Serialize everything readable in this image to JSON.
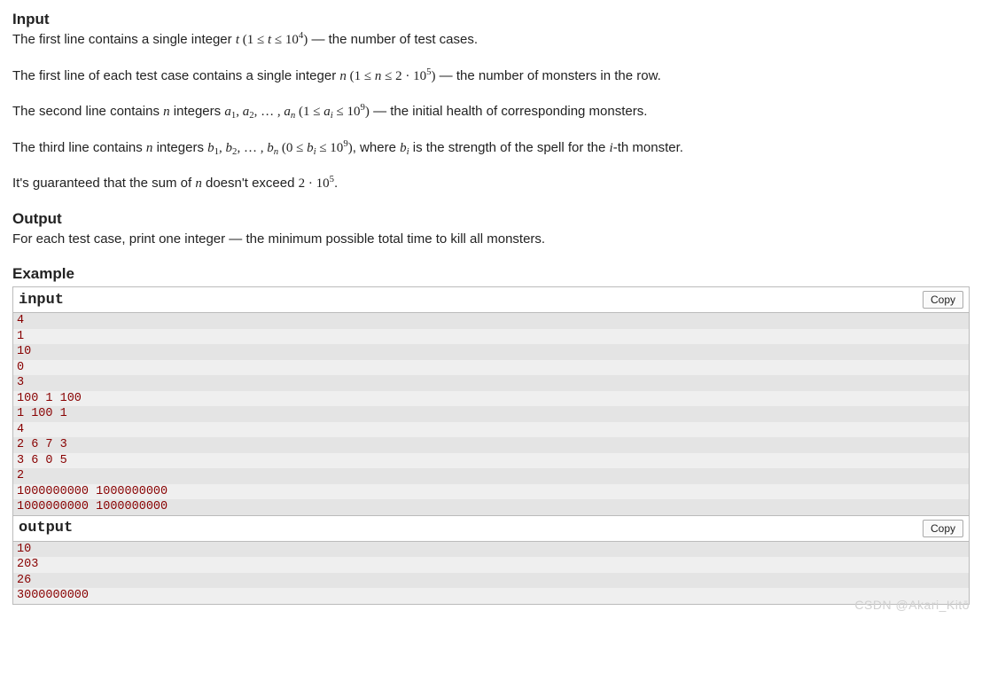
{
  "sections": {
    "input_title": "Input",
    "output_title": "Output",
    "example_title": "Example"
  },
  "input_desc": {
    "line1_a": "The first line contains a single integer ",
    "line1_b": " — the number of test cases.",
    "line1_t": "t",
    "line1_cond_open": " (",
    "line1_cond_a": "1 ≤ ",
    "line1_cond_b": " ≤ 10",
    "line1_cond_exp": "4",
    "line1_cond_close": ")",
    "line2_a": "The first line of each test case contains a single integer ",
    "line2_n": "n",
    "line2_b": " (",
    "line2_c": "1 ≤ ",
    "line2_d": " ≤ 2 · 10",
    "line2_exp": "5",
    "line2_e": ")",
    "line2_f": " — the number of monsters in the row.",
    "line3_a": "The second line contains ",
    "line3_n": "n",
    "line3_b": " integers ",
    "line3_seq_a": "a",
    "line3_sub1": "1",
    "line3_sep": ", ",
    "line3_sub2": "2",
    "line3_dots": ", … , ",
    "line3_subn": "n",
    "line3_c": " (",
    "line3_cond_a": "1 ≤ ",
    "line3_ai": "a",
    "line3_ai_sub": "i",
    "line3_cond_b": " ≤ 10",
    "line3_exp": "9",
    "line3_d": ")",
    "line3_e": " — the initial health of corresponding monsters.",
    "line4_a": "The third line contains ",
    "line4_n": "n",
    "line4_b": " integers ",
    "line4_seq_b": "b",
    "line4_sub1": "1",
    "line4_sep": ", ",
    "line4_sub2": "2",
    "line4_dots": ", … , ",
    "line4_subn": "n",
    "line4_c": " (",
    "line4_cond_a": "0 ≤ ",
    "line4_bi": "b",
    "line4_bi_sub": "i",
    "line4_cond_b": " ≤ 10",
    "line4_exp": "9",
    "line4_d": ")",
    "line4_e": ", where ",
    "line4_f": " is the strength of the spell for the ",
    "line4_i": "i",
    "line4_g": "-th monster.",
    "line5_a": "It's guaranteed that the sum of ",
    "line5_n": "n",
    "line5_b": " doesn't exceed ",
    "line5_c": "2 · 10",
    "line5_exp": "5",
    "line5_d": "."
  },
  "output_desc": "For each test case, print one integer — the minimum possible total time to kill all monsters.",
  "example": {
    "input_label": "input",
    "output_label": "output",
    "copy_label": "Copy",
    "input_lines": [
      "4",
      "1",
      "10",
      "0",
      "3",
      "100 1 100",
      "1 100 1",
      "4",
      "2 6 7 3",
      "3 6 0 5",
      "2",
      "1000000000 1000000000",
      "1000000000 1000000000"
    ],
    "output_lines": [
      "10",
      "203",
      "26",
      "3000000000"
    ]
  },
  "watermark": "CSDN @Akari_Kitō"
}
